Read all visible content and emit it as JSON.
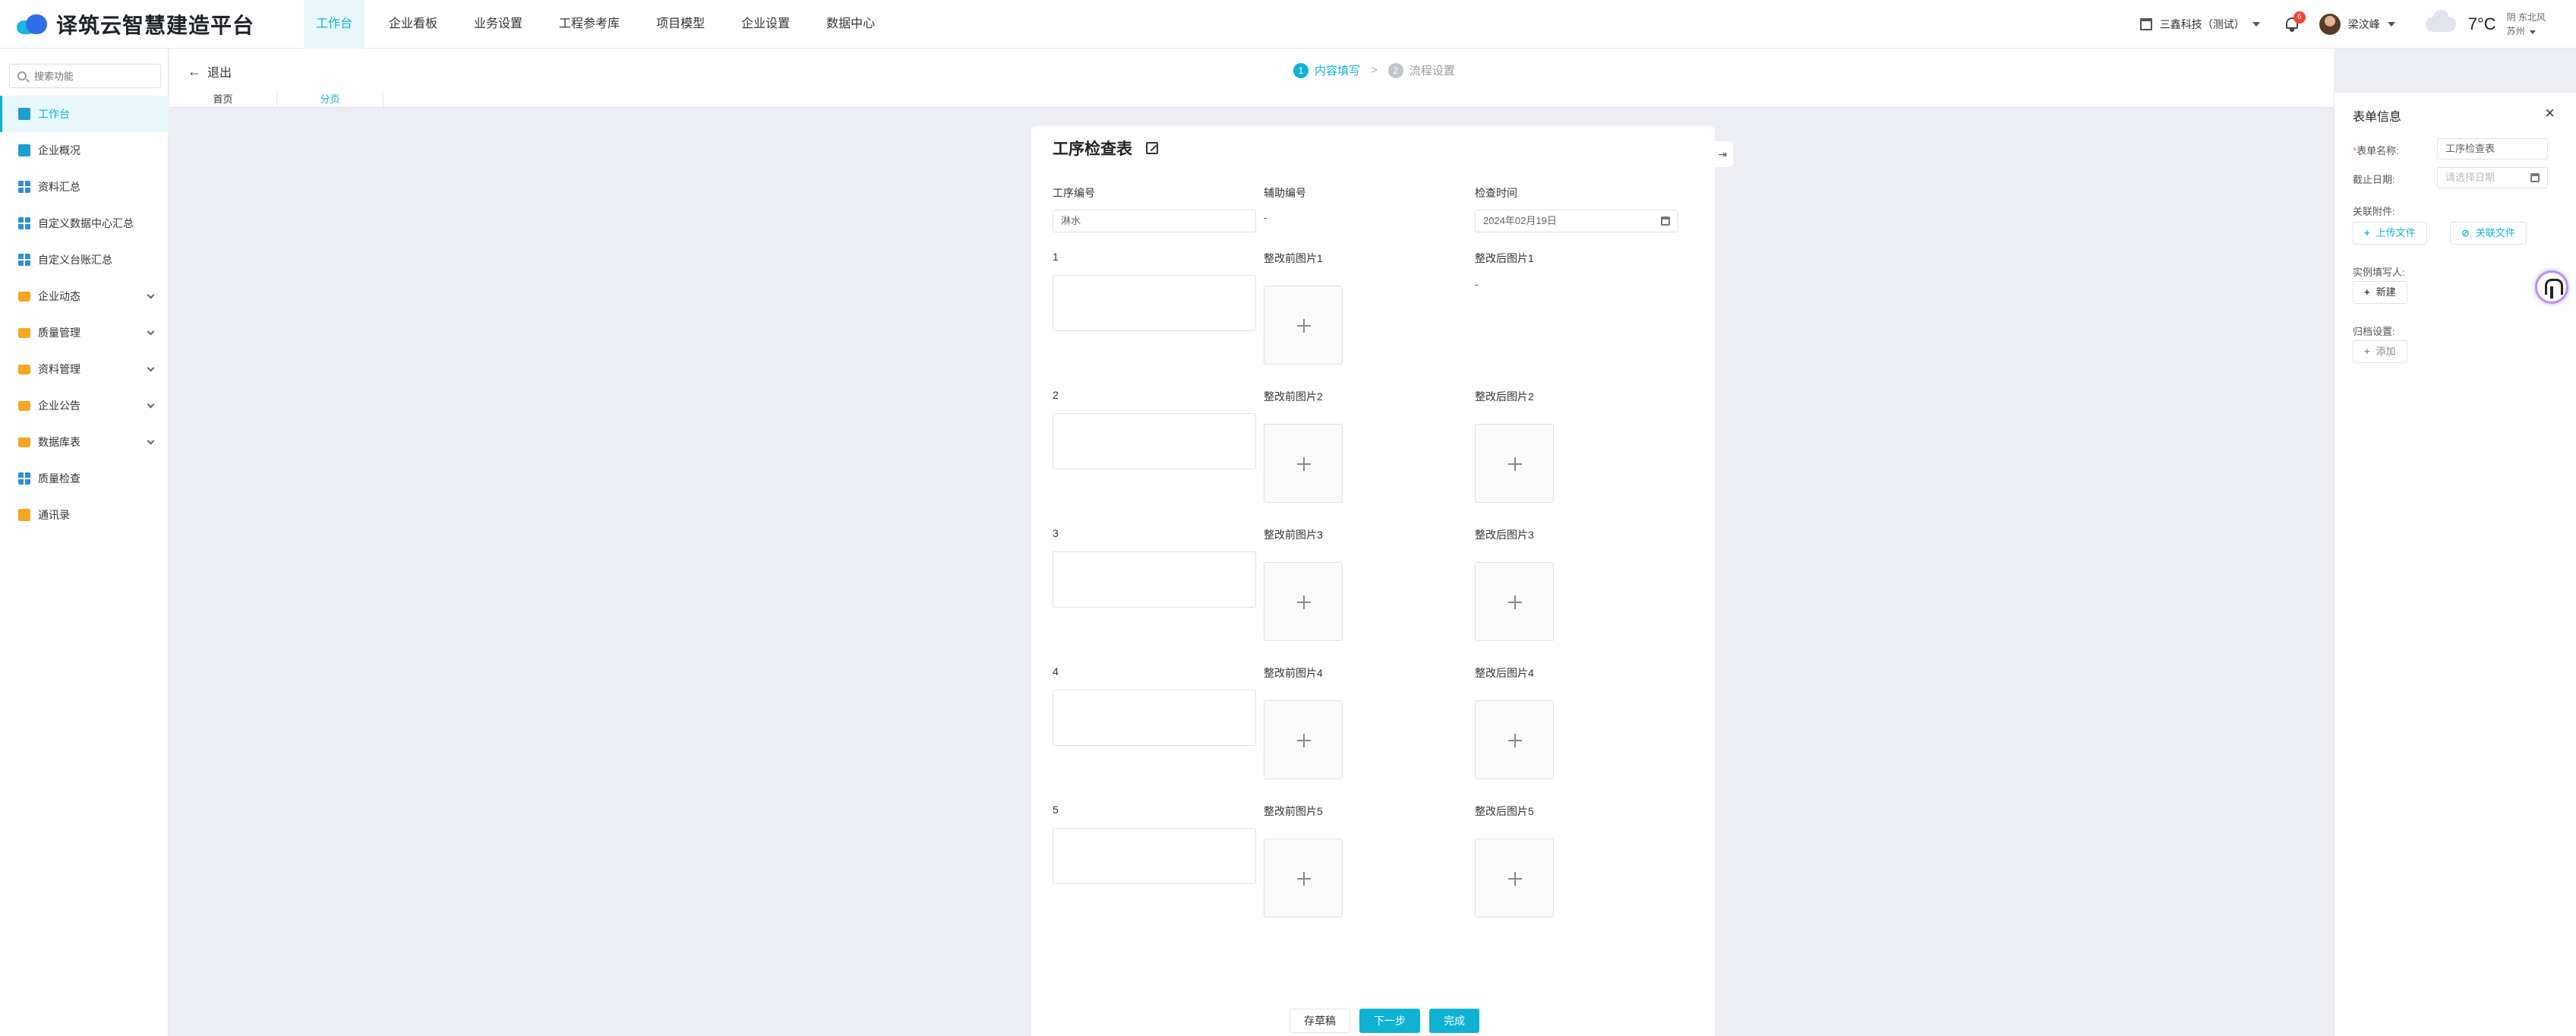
{
  "app": {
    "logo_text": "译筑云智慧建造平台",
    "nav": [
      "工作台",
      "企业看板",
      "业务设置",
      "工程参考库",
      "项目模型",
      "企业设置",
      "数据中心"
    ],
    "company": "三鑫科技（测试）",
    "notifications": "6",
    "user_name": "梁汶峰",
    "temperature": "7°C",
    "weather_desc": "阴 东北风",
    "city": "苏州"
  },
  "sidebar": {
    "search_placeholder": "搜索功能",
    "items": [
      {
        "label": "工作台",
        "icon": "chart-icon"
      },
      {
        "label": "企业概况",
        "icon": "chart-icon"
      },
      {
        "label": "资料汇总",
        "icon": "grid-icon"
      },
      {
        "label": "自定义数据中心汇总",
        "icon": "grid-icon"
      },
      {
        "label": "自定义台账汇总",
        "icon": "grid-icon"
      },
      {
        "label": "企业动态",
        "icon": "folder-icon"
      },
      {
        "label": "质量管理",
        "icon": "folder-icon"
      },
      {
        "label": "资料管理",
        "icon": "folder-icon"
      },
      {
        "label": "企业公告",
        "icon": "folder-icon"
      },
      {
        "label": "数据库表",
        "icon": "folder-icon"
      },
      {
        "label": "质量检查",
        "icon": "grid-icon"
      },
      {
        "label": "通讯录",
        "icon": "book-icon"
      }
    ]
  },
  "subbar": {
    "back_label": "退出",
    "steps": [
      {
        "num": "1",
        "label": "内容填写"
      },
      {
        "num": "2",
        "label": "流程设置"
      }
    ],
    "tabs": [
      "首页",
      "分页"
    ]
  },
  "form": {
    "title": "工序检查表",
    "fields": {
      "proc_no_label": "工序编号",
      "proc_no_value": "淋水",
      "aux_no_label": "辅助编号",
      "aux_no_value": "-",
      "check_time_label": "检查时间",
      "check_time_value": "2024年02月19日"
    },
    "rows": [
      {
        "label": "1",
        "before": "整改前图片1",
        "after": "整改后图片1",
        "after_value": "-"
      },
      {
        "label": "2",
        "before": "整改前图片2",
        "after": "整改后图片2"
      },
      {
        "label": "3",
        "before": "整改前图片3",
        "after": "整改后图片3"
      },
      {
        "label": "4",
        "before": "整改前图片4",
        "after": "整改后图片4"
      },
      {
        "label": "5",
        "before": "整改前图片5",
        "after": "整改后图片5"
      }
    ],
    "buttons": {
      "draft": "存草稿",
      "next": "下一步",
      "finish": "完成"
    }
  },
  "panel": {
    "title": "表单信息",
    "name_label": "表单名称:",
    "name_value": "工序检查表",
    "deadline_label": "截止日期:",
    "deadline_placeholder": "请选择日期",
    "attach_label": "关联附件:",
    "upload_btn": "上传文件",
    "link_btn": "关联文件",
    "filler_label": "实例填写人:",
    "new_btn": "新建",
    "archive_label": "归档设置:",
    "add_btn": "添加"
  }
}
